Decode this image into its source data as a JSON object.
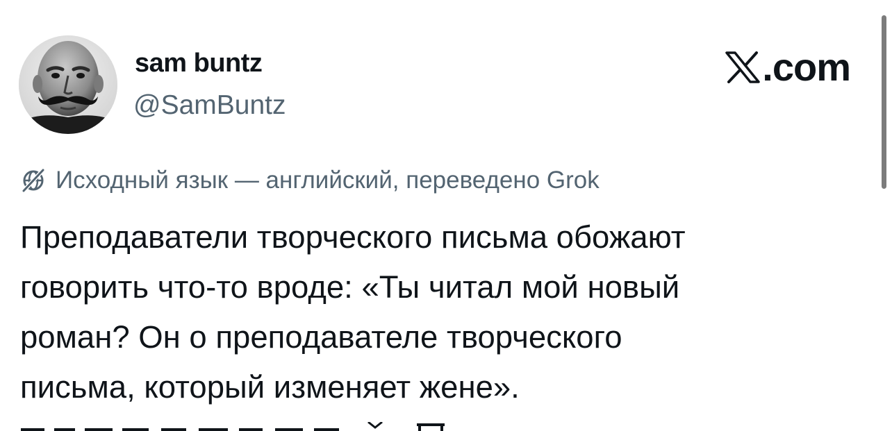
{
  "author": {
    "display_name": "sam buntz",
    "handle": "@SamBuntz"
  },
  "brand": {
    "logo_icon": "x-logo-icon",
    "label": ".com"
  },
  "translation_note": {
    "icon": "globe-off-icon",
    "text": "Исходный язык — английский, переведено Grok"
  },
  "tweet": {
    "lines": [
      "Преподаватели творческого письма обожают",
      "говорить что-то вроде: «Ты читал мой новый",
      "роман? Он о преподавателе творческого",
      "письма, который изменяет жене»."
    ]
  },
  "colors": {
    "primary_text": "#0f1419",
    "secondary_text": "#536471",
    "background": "#ffffff",
    "scrollbar": "#7c7c7c"
  }
}
